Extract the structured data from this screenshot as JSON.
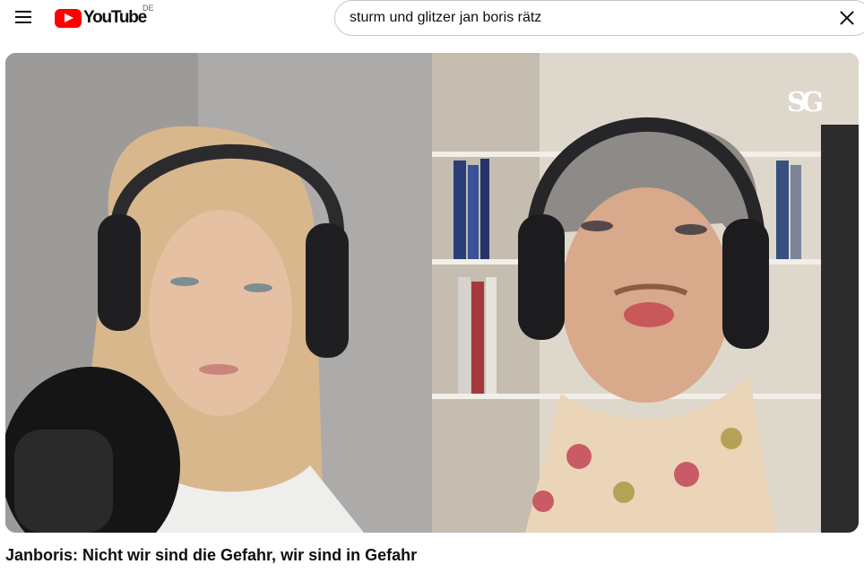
{
  "header": {
    "logo_text": "YouTube",
    "country_code": "DE",
    "search": {
      "value": "sturm und glitzer jan boris rätz"
    }
  },
  "video": {
    "title": "Janboris: Nicht wir sind die Gefahr, wir sind in Gefahr",
    "watermark": "SG"
  },
  "colors": {
    "brand_red": "#ff0000",
    "text_primary": "#0f0f0f",
    "search_border": "#c6c6c6"
  },
  "icons": {
    "menu": "hamburger-menu-icon",
    "logo": "youtube-logo-icon",
    "clear": "close-icon"
  }
}
